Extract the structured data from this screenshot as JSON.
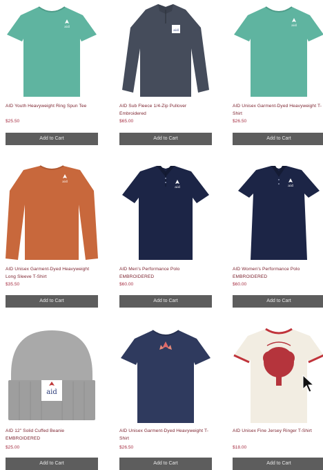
{
  "colors": {
    "title": "#7a1f2b",
    "price": "#a83246",
    "button_bg": "#5d5d5d",
    "button_text": "#e8e8e8"
  },
  "products": [
    {
      "name": "AID Youth Heavyweight Ring Spun Tee",
      "price": "$25.50",
      "button": "Add to Cart",
      "image": "seafoam-tshirt",
      "color": "#5fb4a0"
    },
    {
      "name": "AID Sub Fleece 1/4-Zip Pullover Embroidered",
      "price": "$65.00",
      "button": "Add to Cart",
      "image": "slate-zip-pullover",
      "color": "#454c5b"
    },
    {
      "name": "AID Unisex Garment-Dyed Heavyweight T-Shirt",
      "price": "$26.50",
      "button": "Add to Cart",
      "image": "seafoam-tshirt",
      "color": "#5fb4a0"
    },
    {
      "name": "AID Unisex Garment-Dyed Heavyweight Long Sleeve T-Shirt",
      "price": "$35.50",
      "button": "Add to Cart",
      "image": "orange-longsleeve",
      "color": "#c8683c"
    },
    {
      "name": "AID Men's Performance Polo EMBROIDERED",
      "price": "$60.00",
      "button": "Add to Cart",
      "image": "navy-polo",
      "color": "#1c2546"
    },
    {
      "name": "AID Women's Performance Polo EMBROIDERED",
      "price": "$60.00",
      "button": "Add to Cart",
      "image": "navy-polo",
      "color": "#1c2546"
    },
    {
      "name": "AID 12\" Solid Cuffed Beanie EMBROIDERED",
      "price": "$25.00",
      "button": "Add to Cart",
      "image": "gray-beanie",
      "color": "#a5a5a5"
    },
    {
      "name": "AID Unisex Garment-Dyed Heavyweight T-Shirt",
      "price": "$26.50",
      "button": "Add to Cart",
      "image": "navy-tshirt",
      "color": "#2f3a5e"
    },
    {
      "name": "AID Unisex Fine Jersey Ringer T-Shirt",
      "price": "$18.00",
      "button": "Add to Cart",
      "image": "white-ringer-tshirt",
      "color": "#f2ede2"
    }
  ]
}
